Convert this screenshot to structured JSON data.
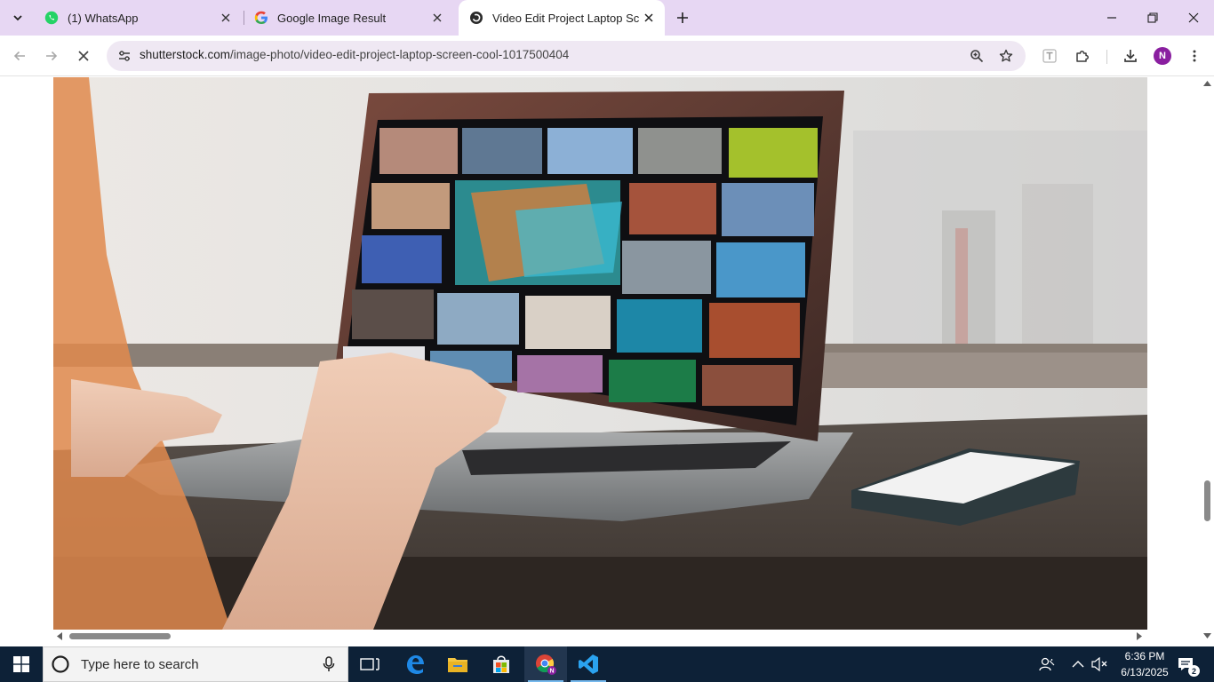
{
  "browser": {
    "tabs": [
      {
        "title": "(1) WhatsApp",
        "icon": "whatsapp-icon",
        "active": false
      },
      {
        "title": "Google Image Result",
        "icon": "google-icon",
        "active": false
      },
      {
        "title": "Video Edit Project Laptop Scree",
        "icon": "shutterstock-icon",
        "active": true
      }
    ],
    "address": {
      "host": "shutterstock.com",
      "path": "/image-photo/video-edit-project-laptop-screen-cool-1017500404"
    },
    "profile_initial": "N",
    "accent_color": "#e7d7f3",
    "profile_color": "#8a1fa0"
  },
  "page": {
    "image_subject": "video-edit-project-laptop-screen",
    "vertical_scroll_fraction": 0.74,
    "horizontal_scroll_fraction": 0.0
  },
  "taskbar": {
    "search_placeholder": "Type here to search",
    "apps": [
      "task-view-icon",
      "edge-icon",
      "file-explorer-icon",
      "store-icon",
      "chrome-icon",
      "vscode-icon"
    ],
    "time": "6:36 PM",
    "date": "6/13/2025",
    "notification_count": "2"
  }
}
